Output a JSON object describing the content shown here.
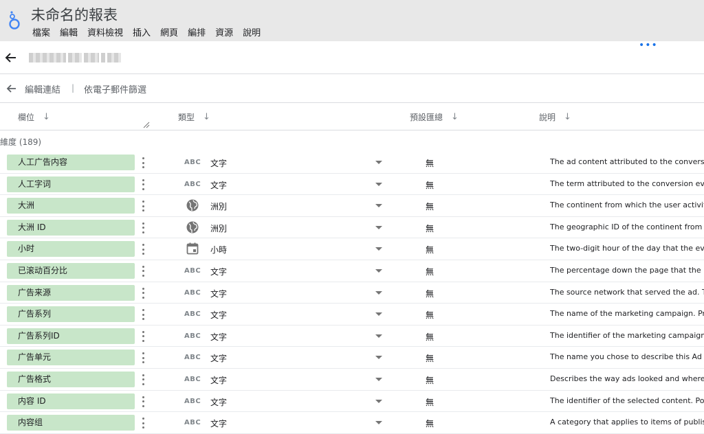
{
  "app": {
    "title": "未命名的報表",
    "menu": [
      "檔案",
      "編輯",
      "資料檢視",
      "插入",
      "網頁",
      "編排",
      "資源",
      "說明"
    ]
  },
  "subbar": {
    "more": "•••"
  },
  "linkbar": {
    "edit_connection": "編輯連結",
    "separator": "|",
    "filter_by_email": "依電子郵件篩選"
  },
  "table": {
    "headers": {
      "field": "欄位",
      "type": "類型",
      "default_agg": "預設匯總",
      "description": "說明",
      "sort_arrow": "↓"
    },
    "dimension_count": "維度 (189)",
    "rows": [
      {
        "field": "人工广告内容",
        "type_icon": "abc",
        "type": "文字",
        "agg": "無",
        "desc": "The ad content attributed to the conversion"
      },
      {
        "field": "人工字词",
        "type_icon": "abc",
        "type": "文字",
        "agg": "無",
        "desc": "The term attributed to the conversion event"
      },
      {
        "field": "大洲",
        "type_icon": "globe",
        "type": "洲別",
        "agg": "無",
        "desc": "The continent from which the user activity"
      },
      {
        "field": "大洲 ID",
        "type_icon": "globe",
        "type": "洲別",
        "agg": "無",
        "desc": "The geographic ID of the continent from wh"
      },
      {
        "field": "小时",
        "type_icon": "calendar",
        "type": "小時",
        "agg": "無",
        "desc": "The two-digit hour of the day that the event"
      },
      {
        "field": "已滚动百分比",
        "type_icon": "abc",
        "type": "文字",
        "agg": "無",
        "desc": "The percentage down the page that the use"
      },
      {
        "field": "广告来源",
        "type_icon": "abc",
        "type": "文字",
        "agg": "無",
        "desc": "The source network that served the ad. Typ"
      },
      {
        "field": "广告系列",
        "type_icon": "abc",
        "type": "文字",
        "agg": "無",
        "desc": "The name of the marketing campaign. Pres"
      },
      {
        "field": "广告系列ID",
        "type_icon": "abc",
        "type": "文字",
        "agg": "無",
        "desc": "The identifier of the marketing campaign. F"
      },
      {
        "field": "广告单元",
        "type_icon": "abc",
        "type": "文字",
        "agg": "無",
        "desc": "The name you chose to describe this Ad ur"
      },
      {
        "field": "广告格式",
        "type_icon": "abc",
        "type": "文字",
        "agg": "無",
        "desc": "Describes the way ads looked and where th"
      },
      {
        "field": "内容 ID",
        "type_icon": "abc",
        "type": "文字",
        "agg": "無",
        "desc": "The identifier of the selected content. Popu"
      },
      {
        "field": "内容组",
        "type_icon": "abc",
        "type": "文字",
        "agg": "無",
        "desc": "A category that applies to items of publish"
      }
    ]
  },
  "colors": {
    "chip": "#c8e6c9",
    "accent": "#1a73e8",
    "topbar": "#e8e8e8"
  },
  "icons": {
    "abc_text": "ABC"
  }
}
